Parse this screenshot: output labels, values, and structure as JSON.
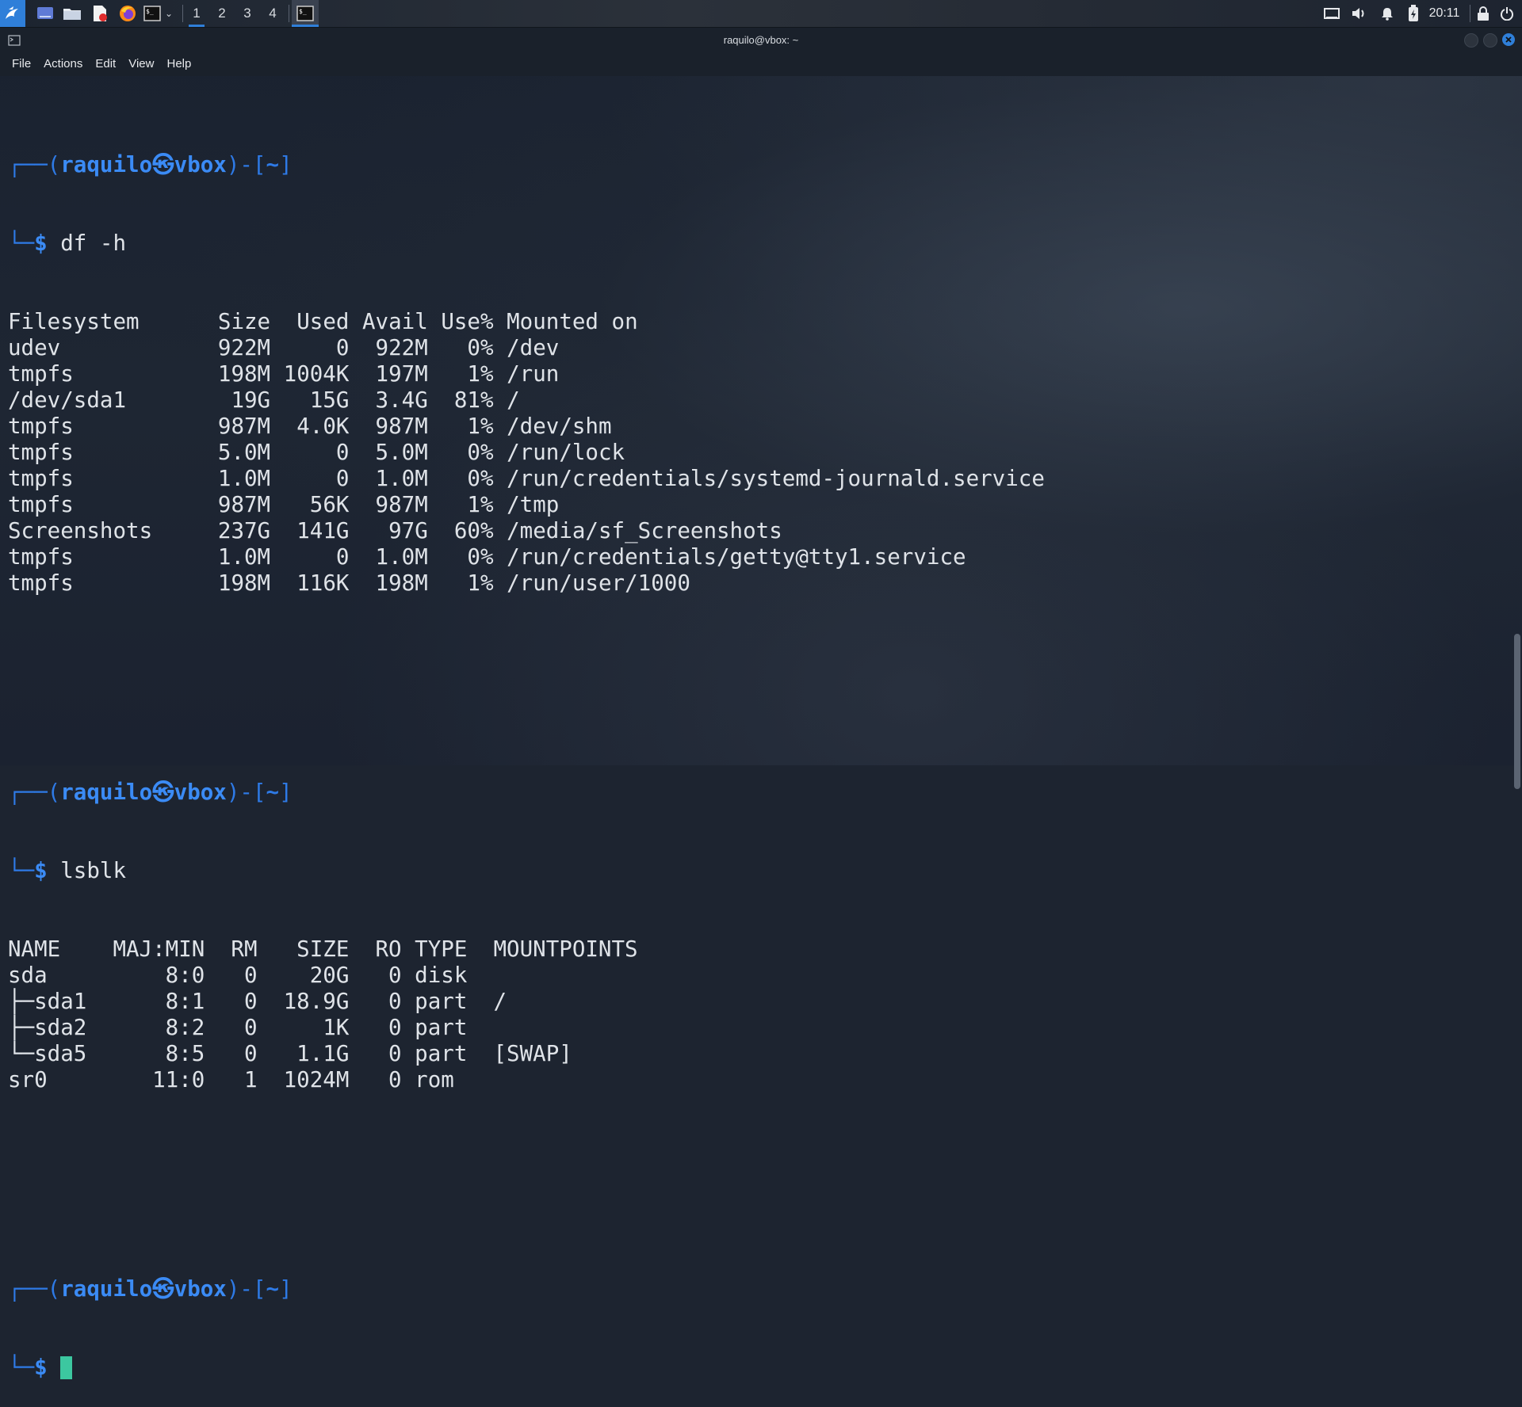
{
  "taskbar": {
    "workspaces": [
      "1",
      "2",
      "3",
      "4"
    ],
    "clock": "20:11"
  },
  "window": {
    "title": "raquilo@vbox: ~",
    "menu": [
      "File",
      "Actions",
      "Edit",
      "View",
      "Help"
    ]
  },
  "prompt": {
    "user": "raquilo",
    "host": "vbox",
    "path": "~"
  },
  "commands": {
    "df": "df -h",
    "lsblk": "lsblk"
  },
  "df": {
    "header": [
      "Filesystem",
      "Size",
      "Used",
      "Avail",
      "Use%",
      "Mounted on"
    ],
    "rows": [
      [
        "udev",
        "922M",
        "0",
        "922M",
        "0%",
        "/dev"
      ],
      [
        "tmpfs",
        "198M",
        "1004K",
        "197M",
        "1%",
        "/run"
      ],
      [
        "/dev/sda1",
        "19G",
        "15G",
        "3.4G",
        "81%",
        "/"
      ],
      [
        "tmpfs",
        "987M",
        "4.0K",
        "987M",
        "1%",
        "/dev/shm"
      ],
      [
        "tmpfs",
        "5.0M",
        "0",
        "5.0M",
        "0%",
        "/run/lock"
      ],
      [
        "tmpfs",
        "1.0M",
        "0",
        "1.0M",
        "0%",
        "/run/credentials/systemd-journald.service"
      ],
      [
        "tmpfs",
        "987M",
        "56K",
        "987M",
        "1%",
        "/tmp"
      ],
      [
        "Screenshots",
        "237G",
        "141G",
        "97G",
        "60%",
        "/media/sf_Screenshots"
      ],
      [
        "tmpfs",
        "1.0M",
        "0",
        "1.0M",
        "0%",
        "/run/credentials/getty@tty1.service"
      ],
      [
        "tmpfs",
        "198M",
        "116K",
        "198M",
        "1%",
        "/run/user/1000"
      ]
    ]
  },
  "lsblk": {
    "header": [
      "NAME",
      "MAJ:MIN",
      "RM",
      "SIZE",
      "RO",
      "TYPE",
      "MOUNTPOINTS"
    ],
    "rows": [
      [
        "sda",
        "8:0",
        "0",
        "20G",
        "0",
        "disk",
        ""
      ],
      [
        "├─sda1",
        "8:1",
        "0",
        "18.9G",
        "0",
        "part",
        "/"
      ],
      [
        "├─sda2",
        "8:2",
        "0",
        "1K",
        "0",
        "part",
        ""
      ],
      [
        "└─sda5",
        "8:5",
        "0",
        "1.1G",
        "0",
        "part",
        "[SWAP]"
      ],
      [
        "sr0",
        "11:0",
        "1",
        "1024M",
        "0",
        "rom",
        ""
      ]
    ]
  },
  "colors": {
    "accent": "#2f7fd9",
    "prompt_blue": "#3b8bf5",
    "cursor": "#3cc7a0",
    "close_button": "#2f7fd9"
  }
}
